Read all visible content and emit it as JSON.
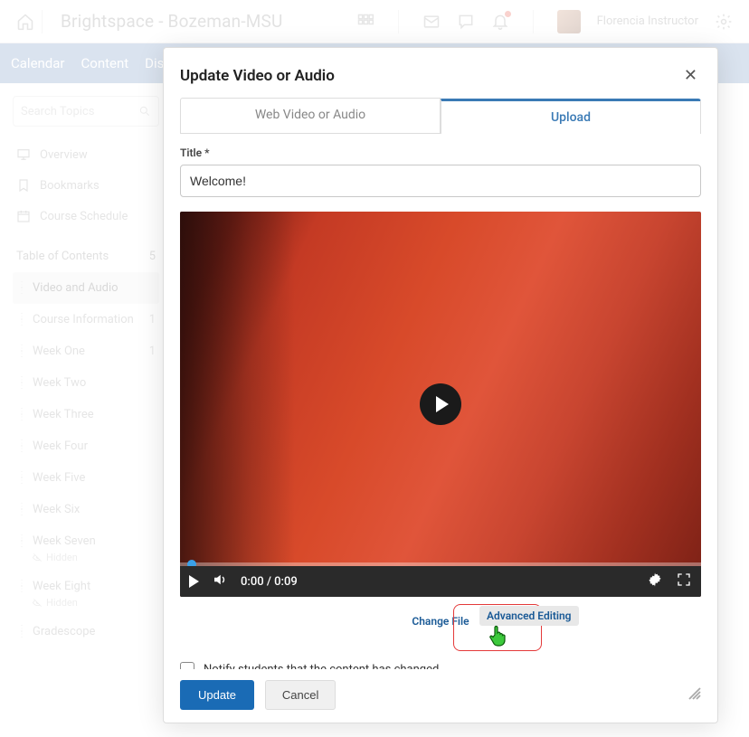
{
  "header": {
    "brand": "Brightspace - Bozeman-MSU",
    "username": "Florencia Instructor"
  },
  "nav": {
    "items": [
      "Calendar",
      "Content",
      "Discu"
    ]
  },
  "sidebar": {
    "search_placeholder": "Search Topics",
    "overview": "Overview",
    "bookmarks": "Bookmarks",
    "schedule": "Course Schedule",
    "toc_header": "Table of Contents",
    "toc_count": "5",
    "items": [
      {
        "label": "Video and Audio",
        "count": "",
        "active": true
      },
      {
        "label": "Course Information",
        "count": "1"
      },
      {
        "label": "Week One",
        "count": "1"
      },
      {
        "label": "Week Two",
        "count": ""
      },
      {
        "label": "Week Three",
        "count": ""
      },
      {
        "label": "Week Four",
        "count": ""
      },
      {
        "label": "Week Five",
        "count": ""
      },
      {
        "label": "Week Six",
        "count": ""
      },
      {
        "label": "Week Seven",
        "count": "",
        "hidden": "Hidden"
      },
      {
        "label": "Week Eight",
        "count": "",
        "hidden": "Hidden"
      },
      {
        "label": "Gradescope",
        "count": ""
      }
    ]
  },
  "modal": {
    "title": "Update Video or Audio",
    "tab_web": "Web Video or Audio",
    "tab_upload": "Upload",
    "field_title_label": "Title *",
    "field_title_value": "Welcome!",
    "video_time": "0:00 / 0:09",
    "change_file": "Change File",
    "advanced_editing": "Advanced Editing",
    "notify_label": "Notify students that the content has changed",
    "update_btn": "Update",
    "cancel_btn": "Cancel"
  }
}
